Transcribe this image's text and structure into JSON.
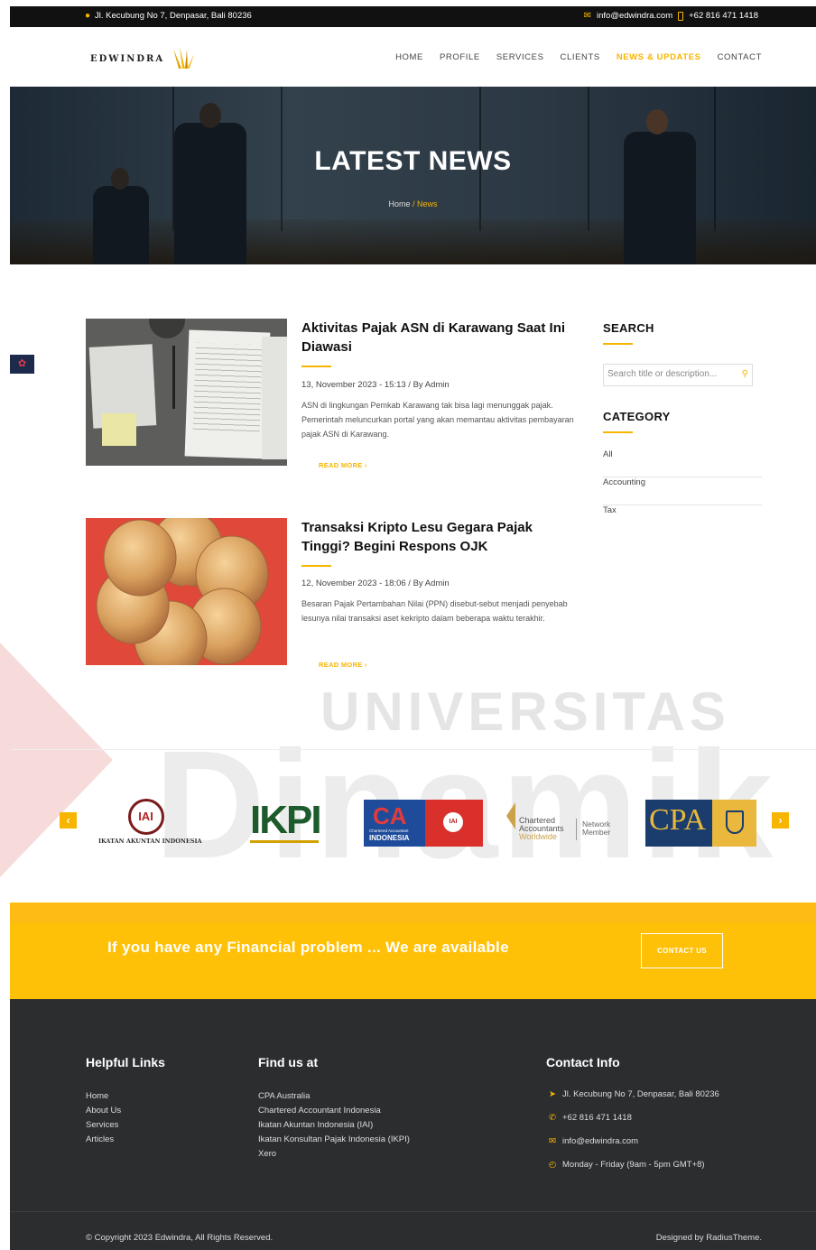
{
  "topbar": {
    "address": "Jl. Kecubung No 7, Denpasar, Bali 80236",
    "email": "info@edwindra.com",
    "phone": "+62 816 471 1418"
  },
  "brand": {
    "name": "EDWINDRA"
  },
  "nav": [
    {
      "label": "HOME",
      "active": false
    },
    {
      "label": "PROFILE",
      "active": false
    },
    {
      "label": "SERVICES",
      "active": false
    },
    {
      "label": "CLIENTS",
      "active": false
    },
    {
      "label": "NEWS & UPDATES",
      "active": true
    },
    {
      "label": "CONTACT",
      "active": false
    }
  ],
  "hero": {
    "title": "LATEST NEWS",
    "breadcrumb_home": "Home",
    "breadcrumb_sep": " / ",
    "breadcrumb_current": "News"
  },
  "posts": [
    {
      "title": "Aktivitas Pajak ASN di Karawang Saat Ini Diawasi",
      "meta": "13, November 2023 - 15:13 / By Admin",
      "excerpt": "ASN di lingkungan Pemkab Karawang tak bisa lagi menunggak pajak. Pemerintah meluncurkan portal yang akan memantau aktivitas pembayaran pajak ASN di Karawang.",
      "read_more": "READ MORE ›"
    },
    {
      "title": "Transaksi Kripto Lesu Gegara Pajak Tinggi? Begini Respons OJK",
      "meta": "12, November 2023 - 18:06 / By Admin",
      "excerpt": "Besaran Pajak Pertambahan Nilai (PPN) disebut-sebut menjadi penyebab lesunya nilai transaksi aset kekripto dalam beberapa waktu terakhir.",
      "read_more": "READ MORE ›"
    }
  ],
  "sidebar": {
    "search_title": "SEARCH",
    "search_placeholder": "Search title or description...",
    "category_title": "CATEGORY",
    "categories": [
      "All",
      "Accounting",
      "Tax"
    ]
  },
  "watermark": {
    "line1": "UNIVERSITAS",
    "line2": "Dinamik"
  },
  "partners": {
    "iai_caption": "IKATAN AKUNTAN INDONESIA",
    "ikpi": "IKPI",
    "ca_text": "CA",
    "ca_sub": "INDONESIA",
    "ca_small": "Chartered Accountant",
    "chartered_line1": "Chartered",
    "chartered_line2": "Accountants",
    "chartered_line3": "Worldwide",
    "network_line1": "Network",
    "network_line2": "Member",
    "cpa": "CPA"
  },
  "cta": {
    "text": "If you have any Financial problem ... We are available",
    "button": "CONTACT US"
  },
  "footer": {
    "helpful_title": "Helpful Links",
    "helpful_links": [
      "Home",
      "About Us",
      "Services",
      "Articles"
    ],
    "findus_title": "Find us at",
    "findus_links": [
      "CPA Australia",
      "Chartered Accountant Indonesia",
      "Ikatan Akuntan Indonesia (IAI)",
      "Ikatan Konsultan Pajak Indonesia (IKPI)",
      "Xero"
    ],
    "contact_title": "Contact Info",
    "contact_address": "Jl. Kecubung No 7, Denpasar, Bali 80236",
    "contact_phone": "+62 816 471 1418",
    "contact_email": "info@edwindra.com",
    "contact_hours": "Monday - Friday (9am - 5pm GMT+8)",
    "copyright": "© Copyright 2023 Edwindra, All Rights Reserved.",
    "designed_by": "Designed by RadiusTheme."
  },
  "colors": {
    "accent": "#f7b500",
    "cta_bg": "#ffc107",
    "footer_bg": "#2b2d2f",
    "topbar_bg": "#111111"
  }
}
